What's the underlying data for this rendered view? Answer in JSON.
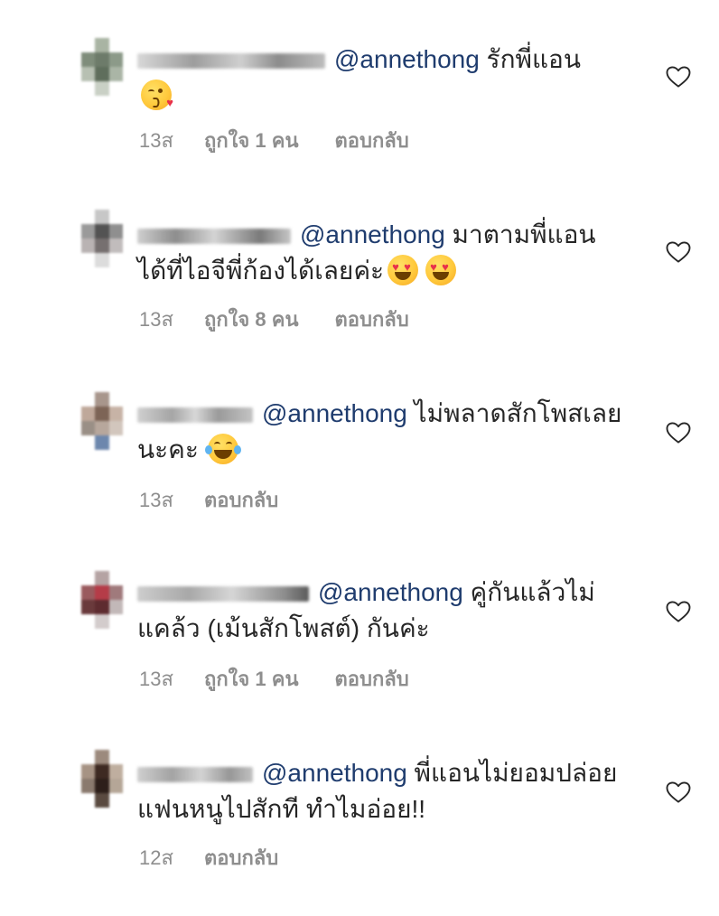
{
  "comments": [
    {
      "mention": "@annethong",
      "text": " รักพี่แอน",
      "emoji": "kiss",
      "time": "13ส",
      "likes": "ถูกใจ 1 คน",
      "reply": "ตอบกลับ",
      "avatar_colors": [
        "#ffffff",
        "#a9b4a3",
        "#ffffff",
        "#7f8d7b",
        "#6d7b6a",
        "#8c9a89",
        "#b7c0b2",
        "#5f6e5c",
        "#aab5a6",
        "#ffffff",
        "#c9d0c5",
        "#ffffff"
      ]
    },
    {
      "mention": "@annethong",
      "text": " มาตามพี่แอนได้ที่ไอจีพี่ก้องได้เลยค่ะ",
      "emoji": "hearts",
      "emoji_count": 2,
      "time": "13ส",
      "likes": "ถูกใจ 8 คน",
      "reply": "ตอบกลับ",
      "avatar_colors": [
        "#ffffff",
        "#c7c7c7",
        "#ffffff",
        "#9a9a9a",
        "#535353",
        "#8f8f8f",
        "#b9b3b3",
        "#767070",
        "#c1bcbc",
        "#ffffff",
        "#dcdcdc",
        "#ffffff"
      ]
    },
    {
      "mention": "@annethong",
      "text": " ไม่พลาดสักโพสเลยนะคะ",
      "emoji": "joy",
      "time": "13ส",
      "reply": "ตอบกลับ",
      "avatar_colors": [
        "#ffffff",
        "#a8968c",
        "#ffffff",
        "#bfa89a",
        "#7d6456",
        "#c7b3a6",
        "#9a8f86",
        "#b7a79c",
        "#d2c6bd",
        "#ffffff",
        "#6d87ad",
        "#ffffff"
      ]
    },
    {
      "mention": "@annethong",
      "text": " คู่กันแล้วไม่แคล้ว (เม้นสักโพสต์) กันค่ะ",
      "emoji": "",
      "time": "13ส",
      "likes": "ถูกใจ 1 คน",
      "reply": "ตอบกลับ",
      "avatar_colors": [
        "#ffffff",
        "#b5a3a3",
        "#ffffff",
        "#9a5a5e",
        "#b53c48",
        "#a07a7c",
        "#6a3a3c",
        "#5e2c30",
        "#c2b8b8",
        "#ffffff",
        "#d3cccc",
        "#ffffff"
      ]
    },
    {
      "mention": "@annethong",
      "text": " พี่แอนไม่ยอมปล่อยแฟนหนูไปสักที ทำไมอ่อย!!",
      "emoji": "",
      "time": "12ส",
      "reply": "ตอบกลับ",
      "avatar_colors": [
        "#ffffff",
        "#9c8a7d",
        "#ffffff",
        "#a69384",
        "#3e2a22",
        "#bfae9f",
        "#8a7a6e",
        "#2d1f1a",
        "#b5a697",
        "#ffffff",
        "#5a4a40",
        "#ffffff"
      ]
    }
  ]
}
